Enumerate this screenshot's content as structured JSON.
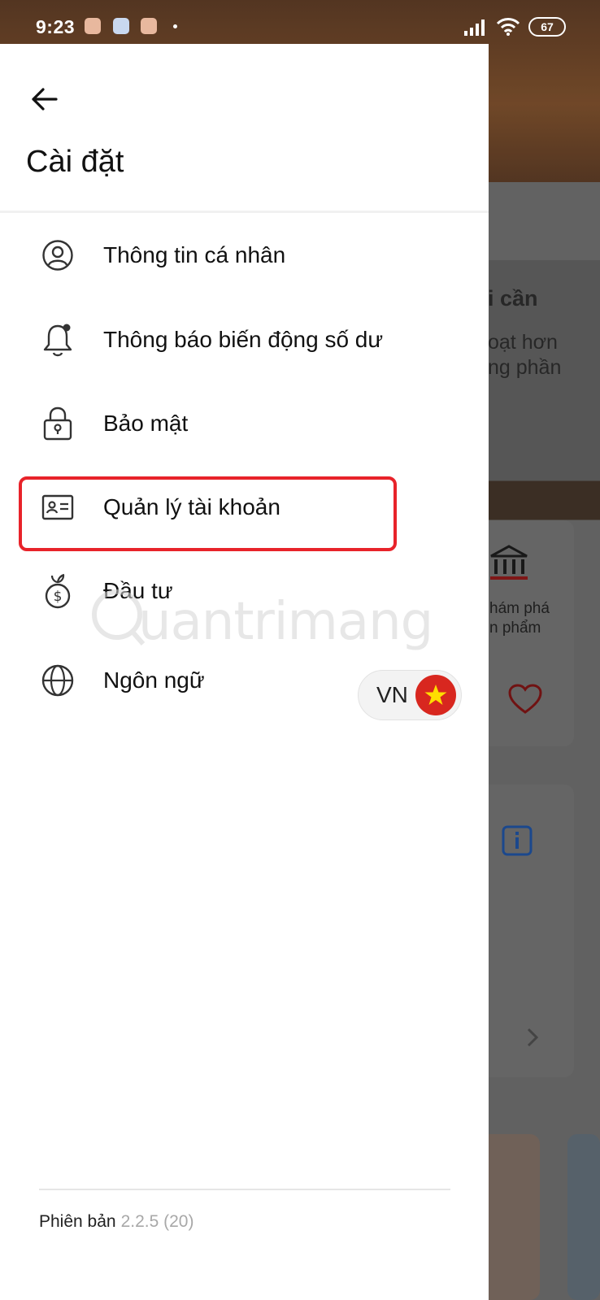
{
  "status_bar": {
    "time": "9:23",
    "battery": "67",
    "icons": [
      "signal-icon",
      "wifi-icon",
      "battery-icon"
    ]
  },
  "background": {
    "banner_title": "i cần",
    "banner_line1": "oạt hơn",
    "banner_line2": "ng phần",
    "card1_line1": "hám phá",
    "card1_line2": "n phẩm"
  },
  "drawer": {
    "title": "Cài đặt",
    "menu": [
      {
        "label": "Thông tin cá nhân",
        "icon": "user-circle-icon"
      },
      {
        "label": "Thông báo biến động số dư",
        "icon": "bell-icon"
      },
      {
        "label": "Bảo mật",
        "icon": "lock-icon"
      },
      {
        "label": "Quản lý tài khoản",
        "icon": "id-card-icon"
      },
      {
        "label": "Đầu tư",
        "icon": "money-bag-icon"
      },
      {
        "label": "Ngôn ngữ",
        "icon": "globe-icon"
      }
    ],
    "language_code": "VN",
    "version_label": "Phiên bản",
    "version_number": "2.2.5 (20)"
  },
  "watermark": "uantrimang",
  "colors": {
    "highlight": "#e8232a",
    "flag_red": "#d8271f",
    "flag_star": "#ffde00"
  }
}
